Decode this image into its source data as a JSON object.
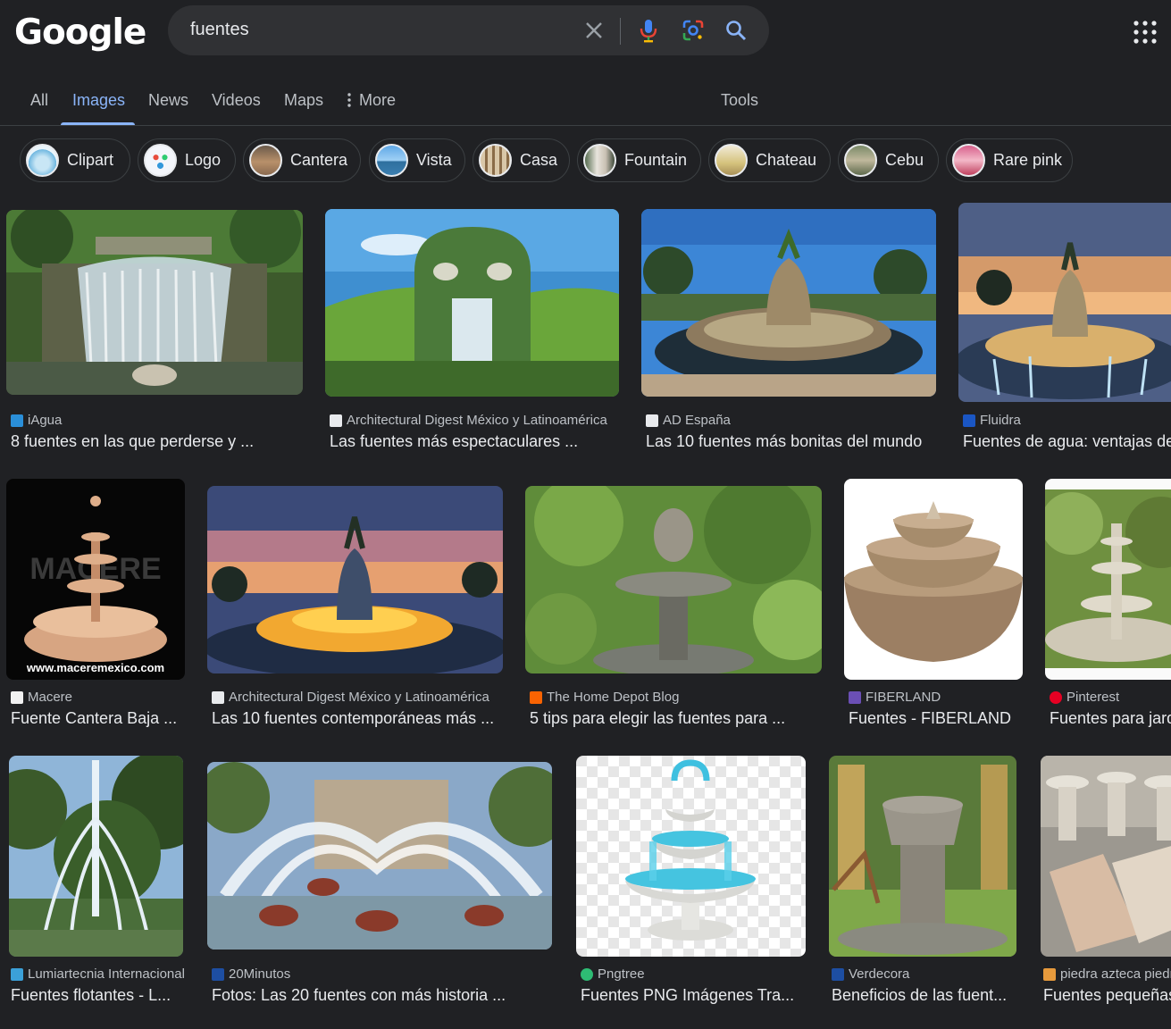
{
  "header": {
    "logo": "Google",
    "query": "fuentes",
    "clear_icon": "close-icon",
    "voice_icon": "mic-icon",
    "lens_icon": "lens-icon",
    "search_icon": "search-icon",
    "apps_icon": "apps-grid-icon"
  },
  "tabs": {
    "all": "All",
    "images": "Images",
    "news": "News",
    "videos": "Videos",
    "maps": "Maps",
    "more": "More",
    "tools": "Tools"
  },
  "chips": [
    {
      "label": "Clipart"
    },
    {
      "label": "Logo"
    },
    {
      "label": "Cantera"
    },
    {
      "label": "Vista"
    },
    {
      "label": "Casa"
    },
    {
      "label": "Fountain"
    },
    {
      "label": "Chateau"
    },
    {
      "label": "Cebu"
    },
    {
      "label": "Rare pink"
    }
  ],
  "results": [
    {
      "source": "iAgua",
      "title": "8 fuentes en las que perderse y ..."
    },
    {
      "source": "Architectural Digest México y Latinoamérica",
      "title": "Las fuentes más espectaculares ..."
    },
    {
      "source": "AD España",
      "title": "Las 10 fuentes más bonitas del mundo"
    },
    {
      "source": "Fluidra",
      "title": "Fuentes de agua: ventajas de"
    },
    {
      "source": "Macere",
      "title": "Fuente Cantera Baja ...",
      "watermark": "www.maceremexico.com",
      "logo_mark": "MACERE"
    },
    {
      "source": "Architectural Digest México y Latinoamérica",
      "title": "Las 10 fuentes contemporáneas más ..."
    },
    {
      "source": "The Home Depot Blog",
      "title": "5 tips para elegir las fuentes para ..."
    },
    {
      "source": "FIBERLAND",
      "title": "Fuentes - FIBERLAND"
    },
    {
      "source": "Pinterest",
      "title": "Fuentes para jard"
    },
    {
      "source": "Lumiartecnia Internacional",
      "title": "Fuentes flotantes - L..."
    },
    {
      "source": "20Minutos",
      "title": "Fotos: Las 20 fuentes con más historia ..."
    },
    {
      "source": "Pngtree",
      "title": "Fuentes PNG Imágenes Tra..."
    },
    {
      "source": "Verdecora",
      "title": "Beneficios de las fuent..."
    },
    {
      "source": "piedra azteca piedra",
      "title": "Fuentes pequeñas"
    }
  ],
  "colors": {
    "background": "#202124",
    "accent": "#8ab4f8",
    "text": "#e8eaed",
    "muted": "#bdc1c6"
  }
}
